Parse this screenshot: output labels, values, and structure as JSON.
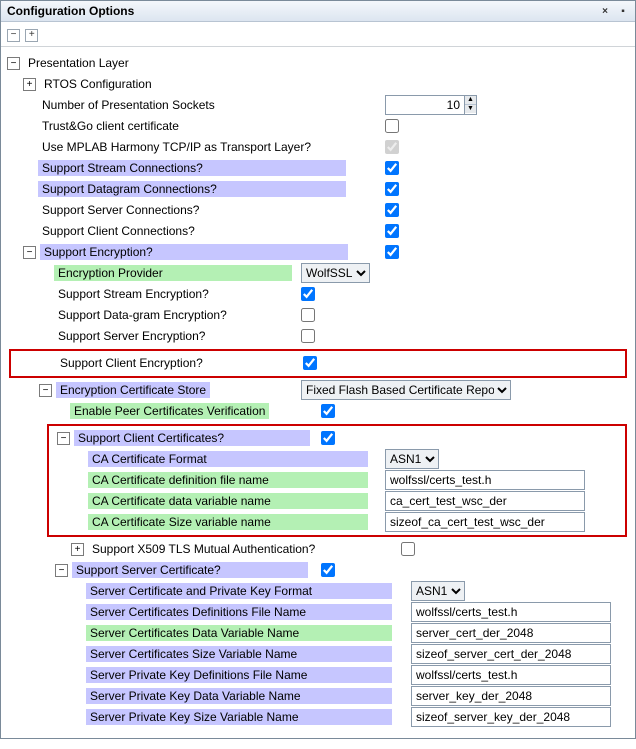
{
  "window": {
    "title": "Configuration Options"
  },
  "tree": {
    "root": {
      "label": "Presentation Layer"
    },
    "rtos": {
      "label": "RTOS Configuration"
    },
    "num_sockets": {
      "label": "Number of Presentation Sockets",
      "value": "10"
    },
    "trustgo": {
      "label": "Trust&Go client certificate"
    },
    "mplab": {
      "label": "Use MPLAB Harmony TCP/IP as Transport Layer?"
    },
    "stream_conn": {
      "label": "Support Stream Connections?"
    },
    "dgram_conn": {
      "label": "Support Datagram Connections?"
    },
    "server_conn": {
      "label": "Support Server Connections?"
    },
    "client_conn": {
      "label": "Support Client Connections?"
    },
    "encryption": {
      "label": "Support Encryption?"
    },
    "enc_provider": {
      "label": "Encryption Provider",
      "value": "WolfSSL"
    },
    "stream_enc": {
      "label": "Support Stream Encryption?"
    },
    "dgram_enc": {
      "label": "Support Data-gram Encryption?"
    },
    "server_enc": {
      "label": "Support Server Encryption?"
    },
    "client_enc": {
      "label": "Support Client Encryption?"
    },
    "cert_store": {
      "label": "Encryption Certificate Store",
      "value": "Fixed Flash Based Certificate Repo"
    },
    "peer_verify": {
      "label": "Enable Peer Certificates Verification"
    },
    "client_certs": {
      "label": "Support Client Certificates?"
    },
    "ca_format": {
      "label": "CA Certificate Format",
      "value": "ASN1"
    },
    "ca_def_file": {
      "label": "CA Certificate definition file name",
      "value": "wolfssl/certs_test.h"
    },
    "ca_data_var": {
      "label": "CA Certificate data variable name",
      "value": "ca_cert_test_wsc_der"
    },
    "ca_size_var": {
      "label": "CA Certificate Size variable name",
      "value": "sizeof_ca_cert_test_wsc_der"
    },
    "x509": {
      "label": "Support X509 TLS Mutual Authentication?"
    },
    "server_cert": {
      "label": "Support Server Certificate?"
    },
    "sc_format": {
      "label": "Server Certificate and Private Key Format",
      "value": "ASN1"
    },
    "sc_def_file": {
      "label": "Server Certificates Definitions File Name",
      "value": "wolfssl/certs_test.h"
    },
    "sc_data_var": {
      "label": "Server Certificates Data Variable Name",
      "value": "server_cert_der_2048"
    },
    "sc_size_var": {
      "label": "Server Certificates Size Variable Name",
      "value": "sizeof_server_cert_der_2048"
    },
    "pk_def_file": {
      "label": "Server Private Key Definitions File Name",
      "value": "wolfssl/certs_test.h"
    },
    "pk_data_var": {
      "label": "Server Private Key Data Variable Name",
      "value": "server_key_der_2048"
    },
    "pk_size_var": {
      "label": "Server Private Key Size Variable Name",
      "value": "sizeof_server_key_der_2048"
    }
  }
}
